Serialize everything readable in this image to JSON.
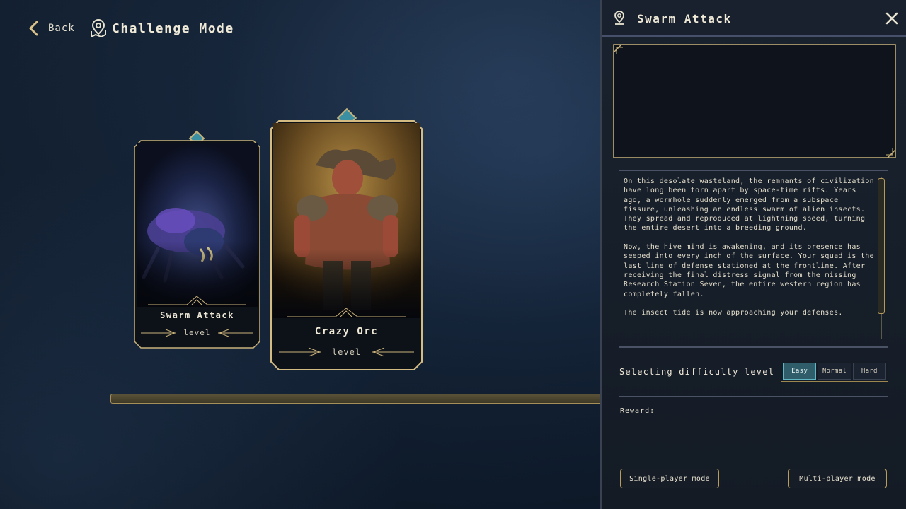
{
  "header": {
    "back_label": "Back",
    "title": "Challenge Mode",
    "back_icon": "chevron-left-icon",
    "title_icon": "map-pin-icon"
  },
  "cards": [
    {
      "name": "Swarm Attack",
      "level_label": "level",
      "selected": false
    },
    {
      "name": "Crazy Orc",
      "level_label": "level",
      "selected": true
    }
  ],
  "progress": {
    "fraction": 0.0
  },
  "panel": {
    "title": "Swarm Attack",
    "pin_icon": "location-pin-icon",
    "close_icon": "close-icon",
    "description": [
      "On this desolate wasteland, the remnants of civilization have long been torn apart by space-time rifts. Years ago, a wormhole suddenly emerged from a subspace fissure, unleashing an endless swarm of alien insects. They spread and reproduced at lightning speed, turning the entire desert into a breeding ground.",
      "Now, the hive mind is awakening, and its presence has seeped into every inch of the surface. Your squad is the last line of defense stationed at the frontline. After receiving the final distress signal from the missing Research Station Seven, the entire western region has completely fallen.",
      "The insect tide is now approaching your defenses."
    ],
    "difficulty": {
      "label": "Selecting difficulty level",
      "options": [
        "Easy",
        "Normal",
        "Hard"
      ],
      "selected": "Easy"
    },
    "reward_label": "Reward:",
    "buttons": {
      "single": "Single-player mode",
      "multi": "Multi-player mode"
    }
  },
  "colors": {
    "accent_gold": "#c9b27a",
    "accent_teal": "#3a8fa3",
    "panel_bg": "#19222e"
  }
}
